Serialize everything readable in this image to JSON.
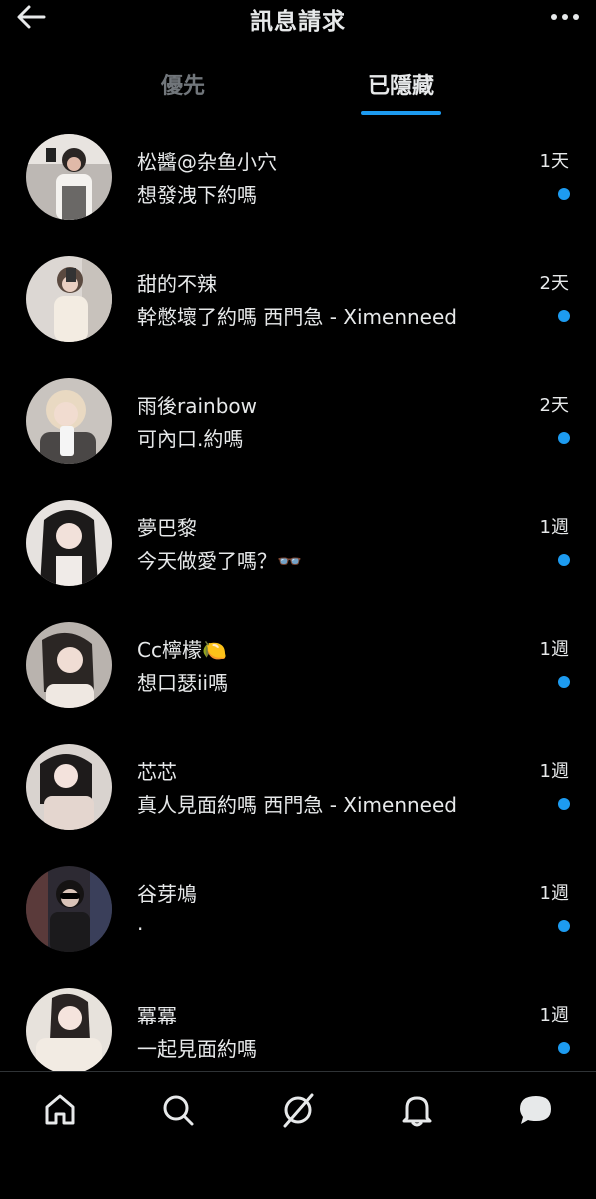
{
  "header": {
    "title": "訊息請求",
    "back_icon": "arrow-left-icon",
    "more_icon": "more-horizontal-icon"
  },
  "tabs": [
    {
      "label": "優先",
      "active": false
    },
    {
      "label": "已隱藏",
      "active": true
    }
  ],
  "colors": {
    "background": "#000000",
    "text_primary": "#e7e9ea",
    "text_secondary": "#71767b",
    "accent": "#1d9bf0"
  },
  "messages": [
    {
      "name": "松醬@杂鱼小穴",
      "preview": "想發洩下約嗎",
      "time": "1天",
      "unread": true
    },
    {
      "name": "甜的不辣",
      "preview": "幹憋壞了約嗎 西門急 - Ximenneed",
      "time": "2天",
      "unread": true
    },
    {
      "name": "雨後rainbow",
      "preview": "可內口.約嗎",
      "time": "2天",
      "unread": true
    },
    {
      "name": "夢巴黎",
      "preview": "今天做愛了嗎？👓",
      "time": "1週",
      "unread": true
    },
    {
      "name": "Cc檸檬🍋",
      "preview": "想口瑟ii嗎",
      "time": "1週",
      "unread": true
    },
    {
      "name": "芯芯",
      "preview": "真人見面約嗎 西門急 - Ximenneed",
      "time": "1週",
      "unread": true
    },
    {
      "name": "谷芽鳩",
      "preview": ".",
      "time": "1週",
      "unread": true
    },
    {
      "name": "冪冪",
      "preview": "一起見面約嗎",
      "time": "1週",
      "unread": true
    }
  ],
  "bottom_nav": [
    {
      "icon": "home-icon"
    },
    {
      "icon": "search-icon"
    },
    {
      "icon": "grok-icon"
    },
    {
      "icon": "bell-icon"
    },
    {
      "icon": "messages-icon",
      "active": true
    }
  ]
}
